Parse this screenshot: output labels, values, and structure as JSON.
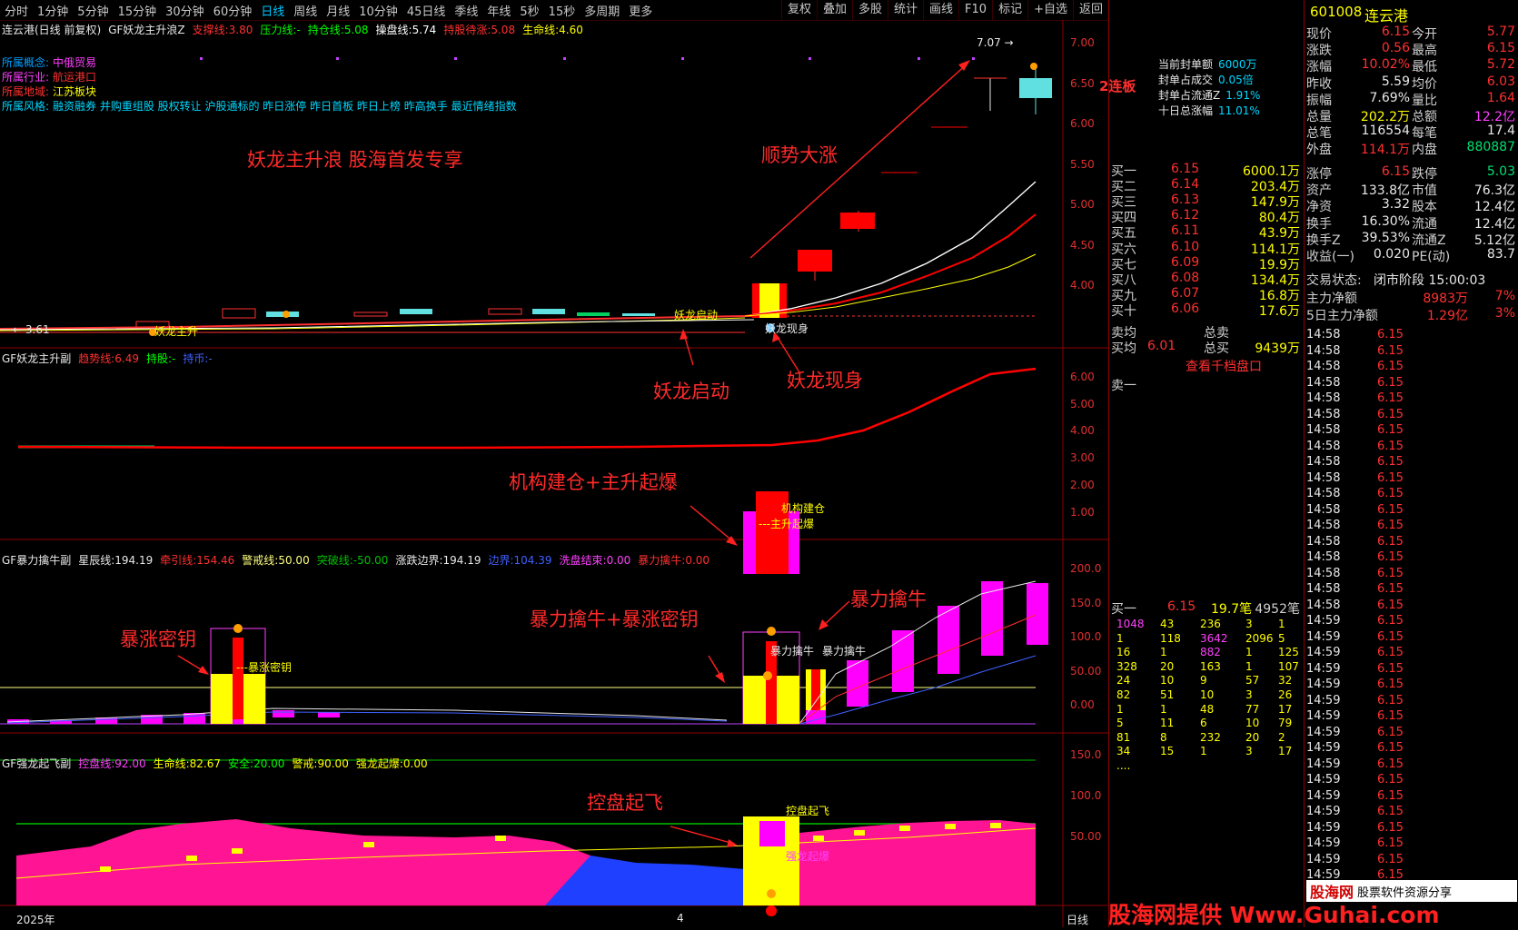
{
  "topbar": {
    "periods": [
      "分时",
      "1分钟",
      "5分钟",
      "15分钟",
      "30分钟",
      "60分钟",
      "日线",
      "周线",
      "月线",
      "10分钟",
      "45日线",
      "季线",
      "年线",
      "5秒",
      "15秒",
      "多周期",
      "更多"
    ],
    "active_index": 6,
    "tools": [
      "复权",
      "叠加",
      "多股",
      "统计",
      "画线",
      "F10",
      "标记",
      "+自选",
      "返回"
    ]
  },
  "pane1": {
    "name": "连云港(日线 前复权)",
    "indicator": "GF妖龙主升浪Z",
    "params": [
      {
        "label": "支撑线:",
        "value": "3.80",
        "color": "#ff3030"
      },
      {
        "label": "压力线:",
        "value": "-",
        "color": "#00ff00"
      },
      {
        "label": "持仓线:",
        "value": "5.08",
        "color": "#00ff00"
      },
      {
        "label": "操盘线:",
        "value": "5.74",
        "color": "#ffffff"
      },
      {
        "label": "持股待涨:",
        "value": "5.08",
        "color": "#ff3030"
      },
      {
        "label": "生命线:",
        "value": "4.60",
        "color": "#ffff00"
      }
    ],
    "info": [
      {
        "label": "所属概念:",
        "value": "中俄贸易",
        "lcolor": "#00a0ff",
        "vcolor": "#ff40ff"
      },
      {
        "label": "所属行业:",
        "value": "航运港口",
        "lcolor": "#ff40ff",
        "vcolor": "#ff3030"
      },
      {
        "label": "所属地域:",
        "value": "江苏板块",
        "lcolor": "#ff3030",
        "vcolor": "#ffff00"
      },
      {
        "label": "所属风格:",
        "value": "融资融券 并购重组股 股权转让 沪股通标的 昨日涨停 昨日首板 昨日上榜 昨高换手 最近情绪指数",
        "lcolor": "#00d8ff",
        "vcolor": "#00d8ff"
      }
    ],
    "banner": "妖龙主升浪 股海首发专享",
    "note_up": "顺势大涨",
    "note_start": "妖龙启动",
    "note_appear": "妖龙现身",
    "lbl_start": "妖龙启动",
    "lbl_appear": "妖龙现身",
    "lbl_low": "妖龙主升",
    "badge": "2连板",
    "peak": "7.07",
    "low": "3.61",
    "yaxis": [
      "7.00",
      "6.50",
      "6.00",
      "5.50",
      "5.00",
      "4.50",
      "4.00"
    ]
  },
  "seal": {
    "rows": [
      {
        "label": "当前封单额",
        "value": "6000万"
      },
      {
        "label": "封单占成交",
        "value": "0.05倍"
      },
      {
        "label": "封单占流通Z",
        "value": "1.91%"
      },
      {
        "label": "十日总涨幅",
        "value": "11.01%"
      }
    ]
  },
  "pane2": {
    "indicator": "GF妖龙主升副",
    "params": [
      {
        "label": "趋势线:",
        "value": "6.49",
        "color": "#ff3030"
      },
      {
        "label": "持股:",
        "value": "-",
        "color": "#00ff00"
      },
      {
        "label": "持币:",
        "value": "-",
        "color": "#4060ff"
      }
    ],
    "note": "机构建仓+主升起爆",
    "lbl1": "机构建仓",
    "lbl2": "主升起爆",
    "yaxis": [
      "6.00",
      "5.00",
      "4.00",
      "3.00",
      "2.00",
      "1.00"
    ]
  },
  "pane3": {
    "indicator": "GF暴力擒牛副",
    "params": [
      {
        "label": "星辰线:",
        "value": "194.19",
        "color": "#e8e8e8"
      },
      {
        "label": "牵引线:",
        "value": "154.46",
        "color": "#ff3030"
      },
      {
        "label": "警戒线:",
        "value": "50.00",
        "color": "#ffff80"
      },
      {
        "label": "突破线:",
        "value": "-50.00",
        "color": "#00c000"
      },
      {
        "label": "涨跌边界:",
        "value": "194.19",
        "color": "#e8e8e8"
      },
      {
        "label": "边界:",
        "value": "104.39",
        "color": "#4060ff"
      },
      {
        "label": "洗盘结束:",
        "value": "0.00",
        "color": "#ff40ff"
      },
      {
        "label": "暴力擒牛:",
        "value": "0.00",
        "color": "#ff3030"
      }
    ],
    "note1": "暴涨密钥",
    "note2": "暴力擒牛+暴涨密钥",
    "note3": "暴力擒牛",
    "lbl1": "暴涨密钥",
    "lbl2": "暴力擒牛",
    "lbl3": "暴力擒牛",
    "yaxis": [
      "200.0",
      "150.0",
      "100.0",
      "50.00",
      "0.00"
    ]
  },
  "pane4": {
    "indicator": "GF强龙起飞副",
    "params": [
      {
        "label": "控盘线:",
        "value": "92.00",
        "color": "#ff40ff"
      },
      {
        "label": "生命线:",
        "value": "82.67",
        "color": "#ffff00"
      },
      {
        "label": "安全:",
        "value": "20.00",
        "color": "#00ff00"
      },
      {
        "label": "警戒:",
        "value": "90.00",
        "color": "#ffff00"
      },
      {
        "label": "强龙起爆:",
        "value": "0.00",
        "color": "#ffff00"
      }
    ],
    "note": "控盘起飞",
    "lbl1": "控盘起飞",
    "lbl2": "强龙起爆",
    "yaxis": [
      "150.0",
      "100.0",
      "50.00"
    ]
  },
  "xaxis": {
    "year": "2025年",
    "mark": "4",
    "period": "日线"
  },
  "orderbook": {
    "bids": [
      {
        "label": "买一",
        "price": "6.15",
        "vol": "6000.1万"
      },
      {
        "label": "买二",
        "price": "6.14",
        "vol": "203.4万"
      },
      {
        "label": "买三",
        "price": "6.13",
        "vol": "147.9万"
      },
      {
        "label": "买四",
        "price": "6.12",
        "vol": "80.4万"
      },
      {
        "label": "买五",
        "price": "6.11",
        "vol": "43.9万"
      },
      {
        "label": "买六",
        "price": "6.10",
        "vol": "114.1万"
      },
      {
        "label": "买七",
        "price": "6.09",
        "vol": "19.9万"
      },
      {
        "label": "买八",
        "price": "6.08",
        "vol": "134.4万"
      },
      {
        "label": "买九",
        "price": "6.07",
        "vol": "16.8万"
      },
      {
        "label": "买十",
        "price": "6.06",
        "vol": "17.6万"
      }
    ],
    "ask_avg_label": "卖均",
    "ask_total_label": "总卖",
    "bid_avg_label": "买均",
    "bid_avg": "6.01",
    "bid_total_label": "总买",
    "bid_total": "9439万",
    "view_link": "查看千档盘口",
    "sell_one": "卖一",
    "buy_one": {
      "label": "买一",
      "price": "6.15",
      "vol": "19.7笔",
      "count": "4952笔"
    },
    "queue": [
      [
        "1048",
        "43",
        "236",
        "3",
        "1"
      ],
      [
        "1",
        "118",
        "3642",
        "2096",
        "5"
      ],
      [
        "16",
        "1",
        "882",
        "1",
        "125"
      ],
      [
        "328",
        "20",
        "163",
        "1",
        "107"
      ],
      [
        "24",
        "10",
        "9",
        "57",
        "32"
      ],
      [
        "82",
        "51",
        "10",
        "3",
        "26"
      ],
      [
        "1",
        "1",
        "48",
        "77",
        "17"
      ],
      [
        "5",
        "11",
        "6",
        "10",
        "79"
      ],
      [
        "81",
        "8",
        "232",
        "20",
        "2"
      ],
      [
        "34",
        "15",
        "1",
        "3",
        "17"
      ],
      [
        "....",
        "",
        "",
        "",
        ""
      ]
    ]
  },
  "quote": {
    "code": "601008",
    "name": "连云港",
    "rows": [
      {
        "l1": "现价",
        "v1": "6.15",
        "c1": "red",
        "l2": "今开",
        "v2": "5.77",
        "c2": "red"
      },
      {
        "l1": "涨跌",
        "v1": "0.56",
        "c1": "red",
        "l2": "最高",
        "v2": "6.15",
        "c2": "red"
      },
      {
        "l1": "涨幅",
        "v1": "10.02%",
        "c1": "red",
        "l2": "最低",
        "v2": "5.72",
        "c2": "red"
      },
      {
        "l1": "昨收",
        "v1": "5.59",
        "c1": "white",
        "l2": "均价",
        "v2": "6.03",
        "c2": "red"
      },
      {
        "l1": "振幅",
        "v1": "7.69%",
        "c1": "white",
        "l2": "量比",
        "v2": "1.64",
        "c2": "red"
      },
      {
        "l1": "总量",
        "v1": "202.2万",
        "c1": "yellow",
        "l2": "总额",
        "v2": "12.2亿",
        "c2": "mag"
      },
      {
        "l1": "总笔",
        "v1": "116554",
        "c1": "white",
        "l2": "每笔",
        "v2": "17.4",
        "c2": "white"
      },
      {
        "l1": "外盘",
        "v1": "114.1万",
        "c1": "red",
        "l2": "内盘",
        "v2": "880887",
        "c2": "green"
      }
    ],
    "rows2": [
      {
        "l1": "涨停",
        "v1": "6.15",
        "c1": "red",
        "l2": "跌停",
        "v2": "5.03",
        "c2": "green"
      },
      {
        "l1": "资产",
        "v1": "133.8亿",
        "c1": "white",
        "l2": "市值",
        "v2": "76.3亿",
        "c2": "white"
      },
      {
        "l1": "净资",
        "v1": "3.32",
        "c1": "white",
        "l2": "股本",
        "v2": "12.4亿",
        "c2": "white"
      },
      {
        "l1": "换手",
        "v1": "16.30%",
        "c1": "white",
        "l2": "流通",
        "v2": "12.4亿",
        "c2": "white"
      },
      {
        "l1": "换手Z",
        "v1": "39.53%",
        "c1": "white",
        "l2": "流通Z",
        "v2": "5.12亿",
        "c2": "white"
      },
      {
        "l1": "收益(一)",
        "v1": "0.020",
        "c1": "white",
        "l2": "PE(动)",
        "v2": "83.7",
        "c2": "white"
      }
    ],
    "status_label": "交易状态:",
    "status": "闭市阶段 15:00:03",
    "flow": [
      {
        "label": "主力净额",
        "value": "8983万",
        "pct": "7%"
      },
      {
        "label": "5日主力净额",
        "value": "1.29亿",
        "pct": "3%"
      }
    ]
  },
  "ticks": [
    [
      "14:58",
      "6.15"
    ],
    [
      "14:58",
      "6.15"
    ],
    [
      "14:58",
      "6.15"
    ],
    [
      "14:58",
      "6.15"
    ],
    [
      "14:58",
      "6.15"
    ],
    [
      "14:58",
      "6.15"
    ],
    [
      "14:58",
      "6.15"
    ],
    [
      "14:58",
      "6.15"
    ],
    [
      "14:58",
      "6.15"
    ],
    [
      "14:58",
      "6.15"
    ],
    [
      "14:58",
      "6.15"
    ],
    [
      "14:58",
      "6.15"
    ],
    [
      "14:58",
      "6.15"
    ],
    [
      "14:58",
      "6.15"
    ],
    [
      "14:58",
      "6.15"
    ],
    [
      "14:58",
      "6.15"
    ],
    [
      "14:58",
      "6.15"
    ],
    [
      "14:58",
      "6.15"
    ],
    [
      "14:59",
      "6.15"
    ],
    [
      "14:59",
      "6.15"
    ],
    [
      "14:59",
      "6.15"
    ],
    [
      "14:59",
      "6.15"
    ],
    [
      "14:59",
      "6.15"
    ],
    [
      "14:59",
      "6.15"
    ],
    [
      "14:59",
      "6.15"
    ],
    [
      "14:59",
      "6.15"
    ],
    [
      "14:59",
      "6.15"
    ],
    [
      "14:59",
      "6.15"
    ],
    [
      "14:59",
      "6.15"
    ],
    [
      "14:59",
      "6.15"
    ],
    [
      "14:59",
      "6.15"
    ],
    [
      "14:59",
      "6.15"
    ],
    [
      "14:59",
      "6.15"
    ],
    [
      "14:59",
      "6.15"
    ],
    [
      "14:59",
      "6.15"
    ],
    [
      "14:59",
      "6.15"
    ]
  ],
  "watermark": {
    "brand": "股海网",
    "slogan": "股票软件资源分享",
    "provider": "股海网提供",
    "url": "Www.Guhai.com"
  }
}
